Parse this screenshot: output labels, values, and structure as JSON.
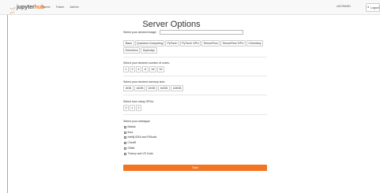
{
  "header": {
    "logo_jupyter": "jupyter",
    "logo_hub": "hub",
    "nav": [
      "Home",
      "Token",
      "Admin"
    ],
    "username": "u0e78d461",
    "logout_label": "Logout"
  },
  "page": {
    "title": "Server Options"
  },
  "image_section": {
    "label": "Select your desired image:",
    "value": "",
    "options": [
      "Base",
      "Quantum Computing",
      "PyTorch",
      "PyTorch GPU",
      "TensorFlow",
      "TensorFlow GPU",
      "Chemistry",
      "Genomics",
      "Hydrodyn"
    ]
  },
  "cores_section": {
    "label": "Select your desired number of cores:",
    "options": [
      "1",
      "2",
      "4",
      "8",
      "16",
      "32"
    ]
  },
  "memory_section": {
    "label": "Select your desired memory size:",
    "options": [
      "8GB",
      "16GB",
      "32GB",
      "64GB",
      "128GB"
    ]
  },
  "gpu_section": {
    "label": "Select how many GPUs:",
    "options": [
      "0",
      "1",
      "2"
    ]
  },
  "apps_section": {
    "label": "Select your webapps:",
    "apps": [
      "Matlab",
      "Ilora",
      "Intellij IDEA and RStudio",
      "Cloud9",
      "Gitlab",
      "Thonny and VS Code"
    ]
  },
  "start_label": "Start"
}
